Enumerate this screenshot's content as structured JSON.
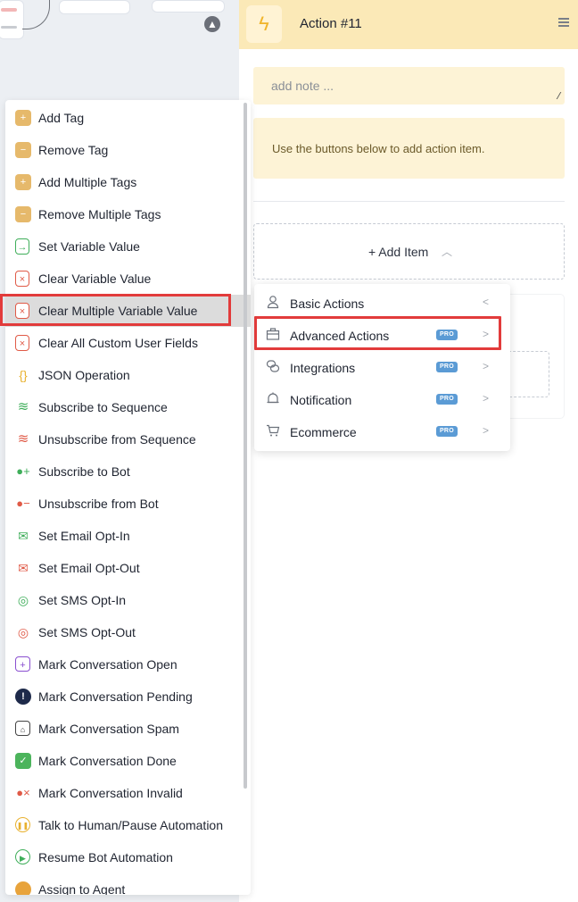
{
  "canvas": {
    "scroll_up_icon": "arrow-up-circle-icon"
  },
  "action": {
    "icon": "bolt-icon",
    "title": "Action #11",
    "menu_icon": "hamburger-menu-icon",
    "note_placeholder": "add note ...",
    "info_text": "Use the buttons below to add action item.",
    "add_item_label": "+ Add Item"
  },
  "dropdown": {
    "items": [
      {
        "label": "Basic Actions",
        "icon": "user-outline-icon",
        "pro": "",
        "arrow": "<"
      },
      {
        "label": "Advanced Actions",
        "icon": "briefcase-icon",
        "pro": "PRO",
        "arrow": ">"
      },
      {
        "label": "Integrations",
        "icon": "link-chain-icon",
        "pro": "PRO",
        "arrow": ">"
      },
      {
        "label": "Notification",
        "icon": "bell-icon",
        "pro": "PRO",
        "arrow": ">"
      },
      {
        "label": "Ecommerce",
        "icon": "cart-icon",
        "pro": "PRO",
        "arrow": ">"
      }
    ]
  },
  "left_menu": {
    "items": [
      {
        "label": "Add Tag",
        "icon": "tag-add-icon"
      },
      {
        "label": "Remove Tag",
        "icon": "tag-remove-icon"
      },
      {
        "label": "Add Multiple Tags",
        "icon": "tags-add-icon"
      },
      {
        "label": "Remove Multiple Tags",
        "icon": "tags-remove-icon"
      },
      {
        "label": "Set Variable Value",
        "icon": "doc-arrow-icon"
      },
      {
        "label": "Clear Variable Value",
        "icon": "doc-x-icon"
      },
      {
        "label": "Clear Multiple Variable Value",
        "icon": "doc-x-icon"
      },
      {
        "label": "Clear All Custom User Fields",
        "icon": "doc-x-icon"
      },
      {
        "label": "JSON Operation",
        "icon": "braces-icon"
      },
      {
        "label": "Subscribe to Sequence",
        "icon": "layers-plus-icon"
      },
      {
        "label": "Unsubscribe from Sequence",
        "icon": "layers-minus-icon"
      },
      {
        "label": "Subscribe to Bot",
        "icon": "user-plus-icon"
      },
      {
        "label": "Unsubscribe from Bot",
        "icon": "user-minus-icon"
      },
      {
        "label": "Set Email Opt-In",
        "icon": "mail-plus-icon"
      },
      {
        "label": "Set Email Opt-Out",
        "icon": "mail-minus-icon"
      },
      {
        "label": "Set SMS Opt-In",
        "icon": "sms-plus-icon"
      },
      {
        "label": "Set SMS Opt-Out",
        "icon": "sms-minus-icon"
      },
      {
        "label": "Mark Conversation Open",
        "icon": "chat-plus-icon"
      },
      {
        "label": "Mark Conversation Pending",
        "icon": "exclamation-icon"
      },
      {
        "label": "Mark Conversation Spam",
        "icon": "spam-inbox-icon"
      },
      {
        "label": "Mark Conversation Done",
        "icon": "chat-check-icon"
      },
      {
        "label": "Mark Conversation Invalid",
        "icon": "user-x-icon"
      },
      {
        "label": "Talk to Human/Pause Automation",
        "icon": "pause-circle-icon"
      },
      {
        "label": "Resume Bot Automation",
        "icon": "play-circle-icon"
      },
      {
        "label": "Assign to Agent",
        "icon": "agent-icon"
      }
    ]
  },
  "colors": {
    "highlight": "#e23b3b",
    "header_bg": "#fbe9b7",
    "note_bg": "#fdf3d6",
    "pro_badge": "#5b9bd5"
  }
}
